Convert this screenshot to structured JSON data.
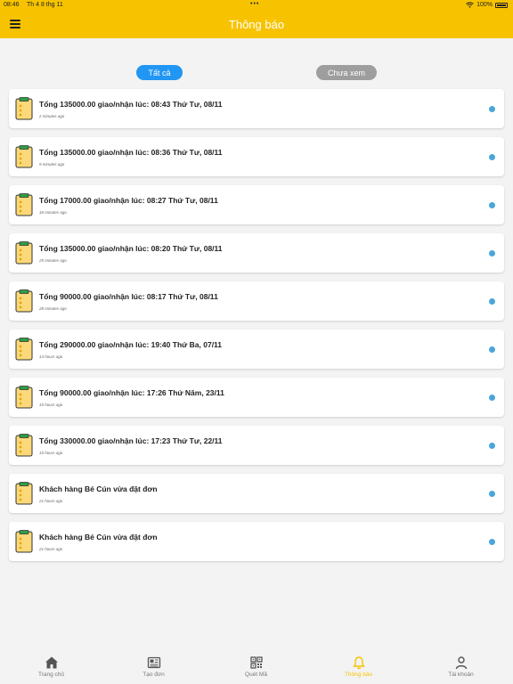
{
  "status_bar": {
    "time": "08:46",
    "date": "Th 4 8 thg 11",
    "dots": "•••",
    "battery": "100%"
  },
  "header": {
    "title": "Thông báo",
    "menu_icon": "hamburger-menu-icon"
  },
  "filters": {
    "all": "Tất cả",
    "unread": "Chưa xem"
  },
  "notifications": [
    {
      "title": "Tổng 135000.00 giao/nhận lúc: 08:43 Thứ Tư, 08/11",
      "time": "2 minutes ago"
    },
    {
      "title": "Tổng 135000.00 giao/nhận lúc: 08:36 Thứ Tư, 08/11",
      "time": "9 minutes ago"
    },
    {
      "title": "Tổng 17000.00 giao/nhận lúc: 08:27 Thứ Tư, 08/11",
      "time": "18 minutes ago"
    },
    {
      "title": "Tổng 135000.00 giao/nhận lúc: 08:20 Thứ Tư, 08/11",
      "time": "25 minutes ago"
    },
    {
      "title": "Tổng 90000.00 giao/nhận lúc: 08:17 Thứ Tư, 08/11",
      "time": "28 minutes ago"
    },
    {
      "title": "Tổng 290000.00 giao/nhận lúc: 19:40 Thứ Ba, 07/11",
      "time": "13 hours ago"
    },
    {
      "title": "Tổng 90000.00 giao/nhận lúc: 17:26 Thứ Năm, 23/11",
      "time": "15 hours ago"
    },
    {
      "title": "Tổng 330000.00 giao/nhận lúc: 17:23 Thứ Tư, 22/11",
      "time": "15 hours ago"
    },
    {
      "title": "Khách hàng Bé Cún vừa đặt đơn",
      "time": "21 hours ago"
    },
    {
      "title": "Khách hàng Bé Cún vừa đặt đơn",
      "time": "21 hours ago"
    }
  ],
  "tabs": {
    "home": "Trang chủ",
    "create": "Tạo đơn",
    "scan": "Quét Mã",
    "notifications": "Thông báo",
    "account": "Tài khoản"
  },
  "colors": {
    "brand": "#f7c300",
    "active_filter": "#2196f3",
    "inactive_filter": "#9e9e9e",
    "unread_dot": "#4aa6d9"
  }
}
